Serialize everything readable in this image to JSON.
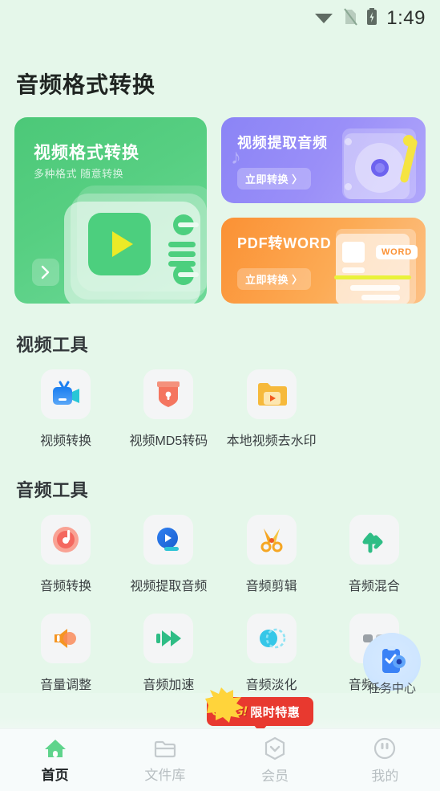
{
  "statusbar": {
    "time": "1:49",
    "wifi_icon": "wifi-icon",
    "sim_icon": "no-sim-icon",
    "battery_icon": "battery-charging-icon"
  },
  "header": {
    "title": "音频格式转换"
  },
  "banners": {
    "main": {
      "title": "视频格式转换",
      "subtitle": "多种格式 随意转换",
      "arrow": "›",
      "color": "#4cc878"
    },
    "side": [
      {
        "title": "视频提取音频",
        "button": "立即转换 〉",
        "color": "#8b84f6",
        "art": "turntable"
      },
      {
        "title": "PDF转WORD",
        "button": "立即转换 〉",
        "color": "#fb9134",
        "art": "document",
        "doc_tag": "WORD"
      }
    ]
  },
  "sections": [
    {
      "title": "视频工具",
      "tools": [
        {
          "label": "视频转换",
          "icon": "video-camera-icon",
          "color": "#2f86f0"
        },
        {
          "label": "视频MD5转码",
          "icon": "shield-lock-icon",
          "color": "#f4755f"
        },
        {
          "label": "本地视频去水印",
          "icon": "folder-play-icon",
          "color": "#f6b93b"
        }
      ]
    },
    {
      "title": "音频工具",
      "tools": [
        {
          "label": "音频转换",
          "icon": "music-disc-icon",
          "color": "#f4685f"
        },
        {
          "label": "视频提取音频",
          "icon": "play-circle-icon",
          "color": "#2f7ff0"
        },
        {
          "label": "音频剪辑",
          "icon": "scissors-icon",
          "color": "#f5a623"
        },
        {
          "label": "音频混合",
          "icon": "mix-arrows-icon",
          "color": "#2ebd85"
        },
        {
          "label": "音量调整",
          "icon": "speaker-icon",
          "color": "#f59522"
        },
        {
          "label": "音频加速",
          "icon": "fast-forward-icon",
          "color": "#2ebd85"
        },
        {
          "label": "音频淡化",
          "icon": "overlap-circles-icon",
          "color": "#35c7e8"
        },
        {
          "label": "音频拼接",
          "icon": "join-icon",
          "color": "#9aa0a6"
        }
      ]
    }
  ],
  "task_center": {
    "label": "任务中心",
    "icon": "clipboard-check-icon"
  },
  "promo": {
    "badge": "OMG!",
    "text": "限时特惠"
  },
  "bottom_nav": [
    {
      "label": "首页",
      "icon": "home-icon",
      "active": true
    },
    {
      "label": "文件库",
      "icon": "folder-icon",
      "active": false
    },
    {
      "label": "会员",
      "icon": "vip-hexagon-icon",
      "active": false
    },
    {
      "label": "我的",
      "icon": "profile-icon",
      "active": false
    }
  ]
}
